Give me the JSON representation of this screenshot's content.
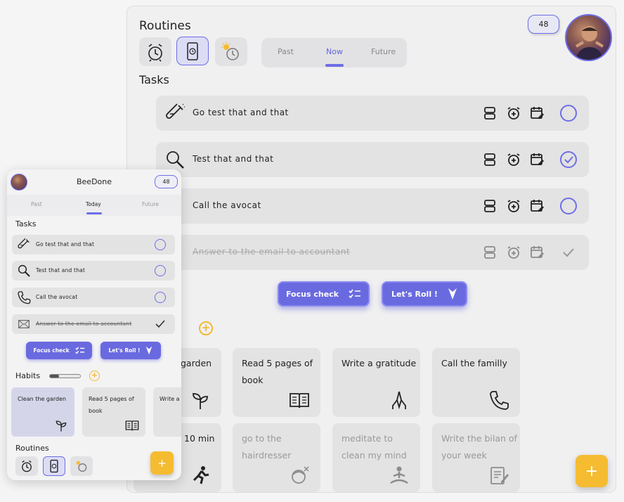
{
  "desktop": {
    "routines_title": "Routines",
    "tabs": [
      "Past",
      "Now",
      "Future"
    ],
    "active_tab": "Now",
    "badge": "48",
    "tasks_title": "Tasks",
    "tasks": [
      {
        "label": "Go test that and that",
        "icon": "test-tube-icon",
        "done": false,
        "checked": false
      },
      {
        "label": "Test that and that",
        "icon": "magnifier-icon",
        "done": false,
        "checked": true
      },
      {
        "label": "Call the avocat",
        "icon": "phone-icon",
        "done": false,
        "checked": false
      },
      {
        "label": "Answer to the email to accountant",
        "icon": "envelope-icon",
        "done": true,
        "checked": true
      }
    ],
    "focus_label": "Focus check",
    "roll_label": "Let's Roll !",
    "habits": [
      {
        "text": "garden",
        "icon": "sprout-icon",
        "faded": false
      },
      {
        "text": "Read 5 pages of book",
        "icon": "book-icon",
        "faded": false
      },
      {
        "text": "Write a gratitude",
        "icon": "praying-hands-icon",
        "faded": false
      },
      {
        "text": "Call the familly",
        "icon": "phone-icon",
        "faded": false
      },
      {
        "text": "10 min",
        "icon": "running-icon",
        "faded": false
      },
      {
        "text": "go to the hairdresser",
        "icon": "haircut-icon",
        "faded": true
      },
      {
        "text": "meditate to clean my mind",
        "icon": "meditation-icon",
        "faded": true
      },
      {
        "text": "Write the bilan of your week",
        "icon": "notepad-icon",
        "faded": true
      }
    ],
    "fab": "+",
    "accent_color": "#6e6ee6",
    "secondary_color": "#f5bc32"
  },
  "mobile": {
    "title": "BeeDone",
    "badge": "48",
    "tabs": [
      "Past",
      "Today",
      "Future"
    ],
    "active_tab": "Today",
    "tasks_title": "Tasks",
    "tasks": [
      {
        "label": "Go test that and that",
        "icon": "test-tube-icon",
        "done": false
      },
      {
        "label": "Test that and that",
        "icon": "magnifier-icon",
        "done": false
      },
      {
        "label": "Call the avocat",
        "icon": "phone-icon",
        "done": false
      },
      {
        "label": "Answer to the email to accountant",
        "icon": "envelope-icon",
        "done": true
      }
    ],
    "focus_label": "Focus check",
    "roll_label": "Let's Roll !",
    "habits_title": "Habits",
    "habits_progress": 0.3,
    "habits": [
      {
        "text": "Clean the garden",
        "icon": "sprout-icon"
      },
      {
        "text": "Read 5 pages of book",
        "icon": "book-icon"
      },
      {
        "text": "Write a",
        "icon": ""
      }
    ],
    "routines_title": "Routines",
    "fab": "+"
  }
}
